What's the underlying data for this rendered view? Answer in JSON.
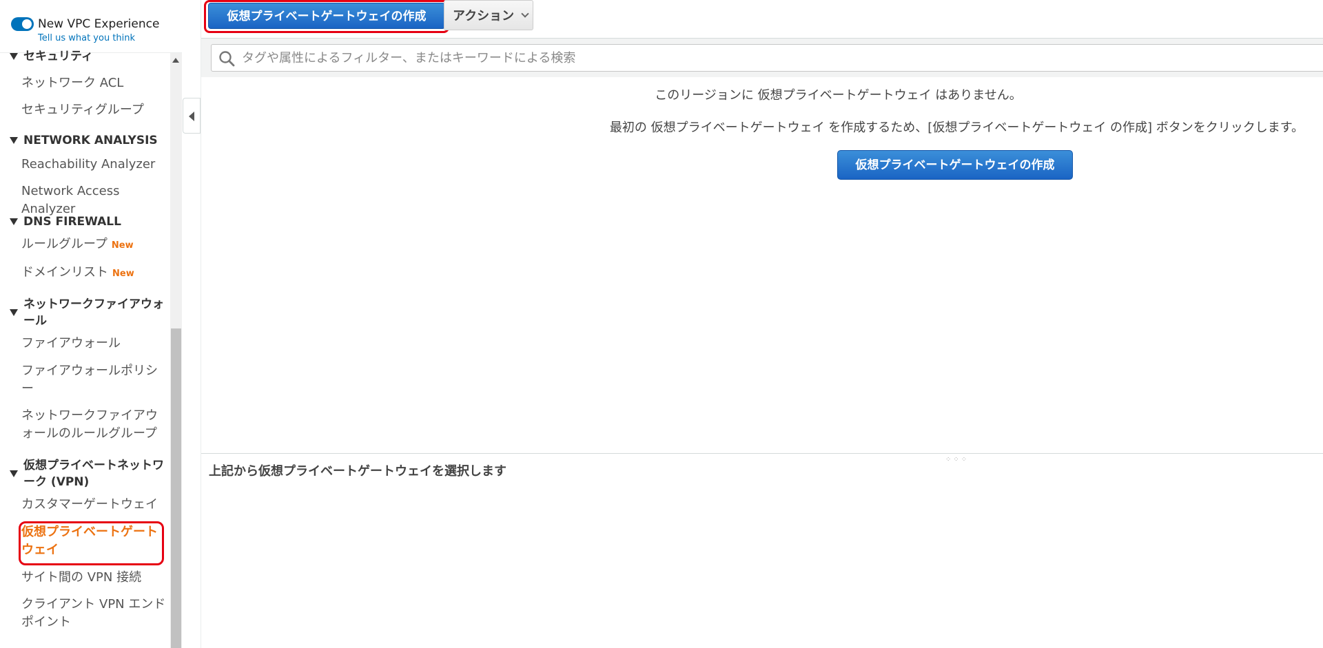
{
  "sidebar": {
    "toggle_label": "New VPC Experience",
    "feedback_link": "Tell us what you think",
    "new_badge": "New",
    "sections": [
      {
        "title": "セキュリティ",
        "items": [
          "ネットワーク ACL",
          "セキュリティグループ"
        ]
      },
      {
        "title": "NETWORK ANALYSIS",
        "items": [
          "Reachability Analyzer",
          "Network Access Analyzer"
        ]
      },
      {
        "title": "DNS FIREWALL",
        "items": [
          "ルールグループ",
          "ドメインリスト"
        ]
      },
      {
        "title": "ネットワークファイアウォール",
        "items": [
          "ファイアウォール",
          "ファイアウォールポリシー",
          "ネットワークファイアウォールのルールグループ"
        ]
      },
      {
        "title": "仮想プライベートネットワーク (VPN)",
        "items": [
          "カスタマーゲートウェイ",
          "仮想プライベートゲートウェイ",
          "サイト間の VPN 接続",
          "クライアント VPN エンドポイント"
        ]
      }
    ],
    "active_item": "仮想プライベートゲートウェイ"
  },
  "toolbar": {
    "create_label": "仮想プライベートゲートウェイの作成",
    "actions_label": "アクション"
  },
  "search": {
    "placeholder": "タグや属性によるフィルター、またはキーワードによる検索",
    "value": ""
  },
  "empty_state": {
    "title": "このリージョンに 仮想プライベートゲートウェイ はありません。",
    "description": "最初の 仮想プライベートゲートウェイ を作成するため、[仮想プライベートゲートウェイ の作成] ボタンをクリックします。",
    "button_label": "仮想プライベートゲートウェイの作成"
  },
  "detail": {
    "prompt": "上記から仮想プライベートゲートウェイを選択します"
  },
  "colors": {
    "accent_blue": "#1a64c4",
    "active_orange": "#ec7211",
    "highlight_red": "#e60012"
  }
}
